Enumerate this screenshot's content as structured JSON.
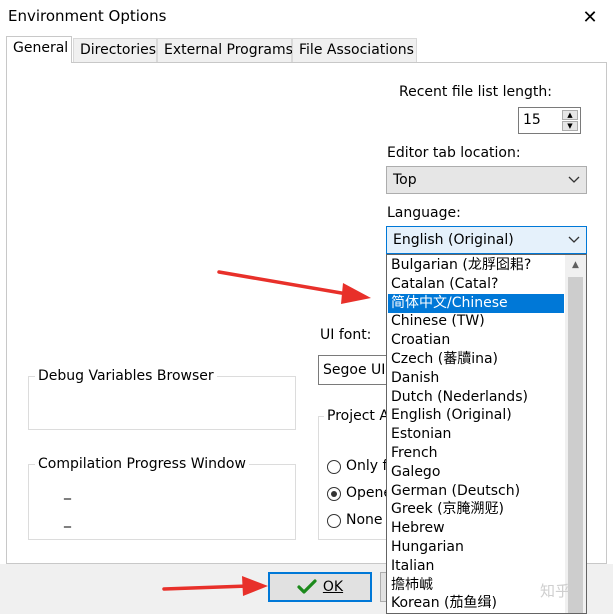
{
  "window": {
    "title": "Environment Options",
    "close_glyph": "✕"
  },
  "tabs": [
    {
      "label": "General",
      "active": true
    },
    {
      "label": "Directories",
      "active": false
    },
    {
      "label": "External Programs",
      "active": false
    },
    {
      "label": "File Associations",
      "active": false
    }
  ],
  "recent_files": {
    "label": "Recent file list length:",
    "value": "15"
  },
  "editor_tab": {
    "label": "Editor tab location:",
    "value": "Top"
  },
  "language": {
    "label": "Language:",
    "value": "English (Original)",
    "options": [
      "Bulgarian (龙脬囵耜?",
      "Catalan (Catal?",
      "简体中文/Chinese",
      "Chinese (TW)",
      "Croatian",
      "Czech (蕃牘ina)",
      "Danish",
      "Dutch (Nederlands)",
      "English (Original)",
      "Estonian",
      "French",
      "Galego",
      "German (Deutsch)",
      "Greek (京腌溯觃)",
      "Hebrew",
      "Hungarian",
      "Italian",
      "擔杮峸",
      "Korean (茄鱼缉)"
    ],
    "selected_index": 2
  },
  "ui_font": {
    "label": "UI font:",
    "value": "Segoe UI"
  },
  "debug_group": {
    "title": "Debug Variables Browser"
  },
  "compile_group": {
    "title": "Compilation Progress Window",
    "dash1": "_",
    "dash2": "_"
  },
  "project_group": {
    "title": "Project A",
    "options": [
      {
        "label": "Only f",
        "checked": false
      },
      {
        "label": "Opene",
        "checked": true
      },
      {
        "label": "None",
        "checked": false
      }
    ]
  },
  "buttons": {
    "ok_label": "OK"
  },
  "watermark": "知乎"
}
